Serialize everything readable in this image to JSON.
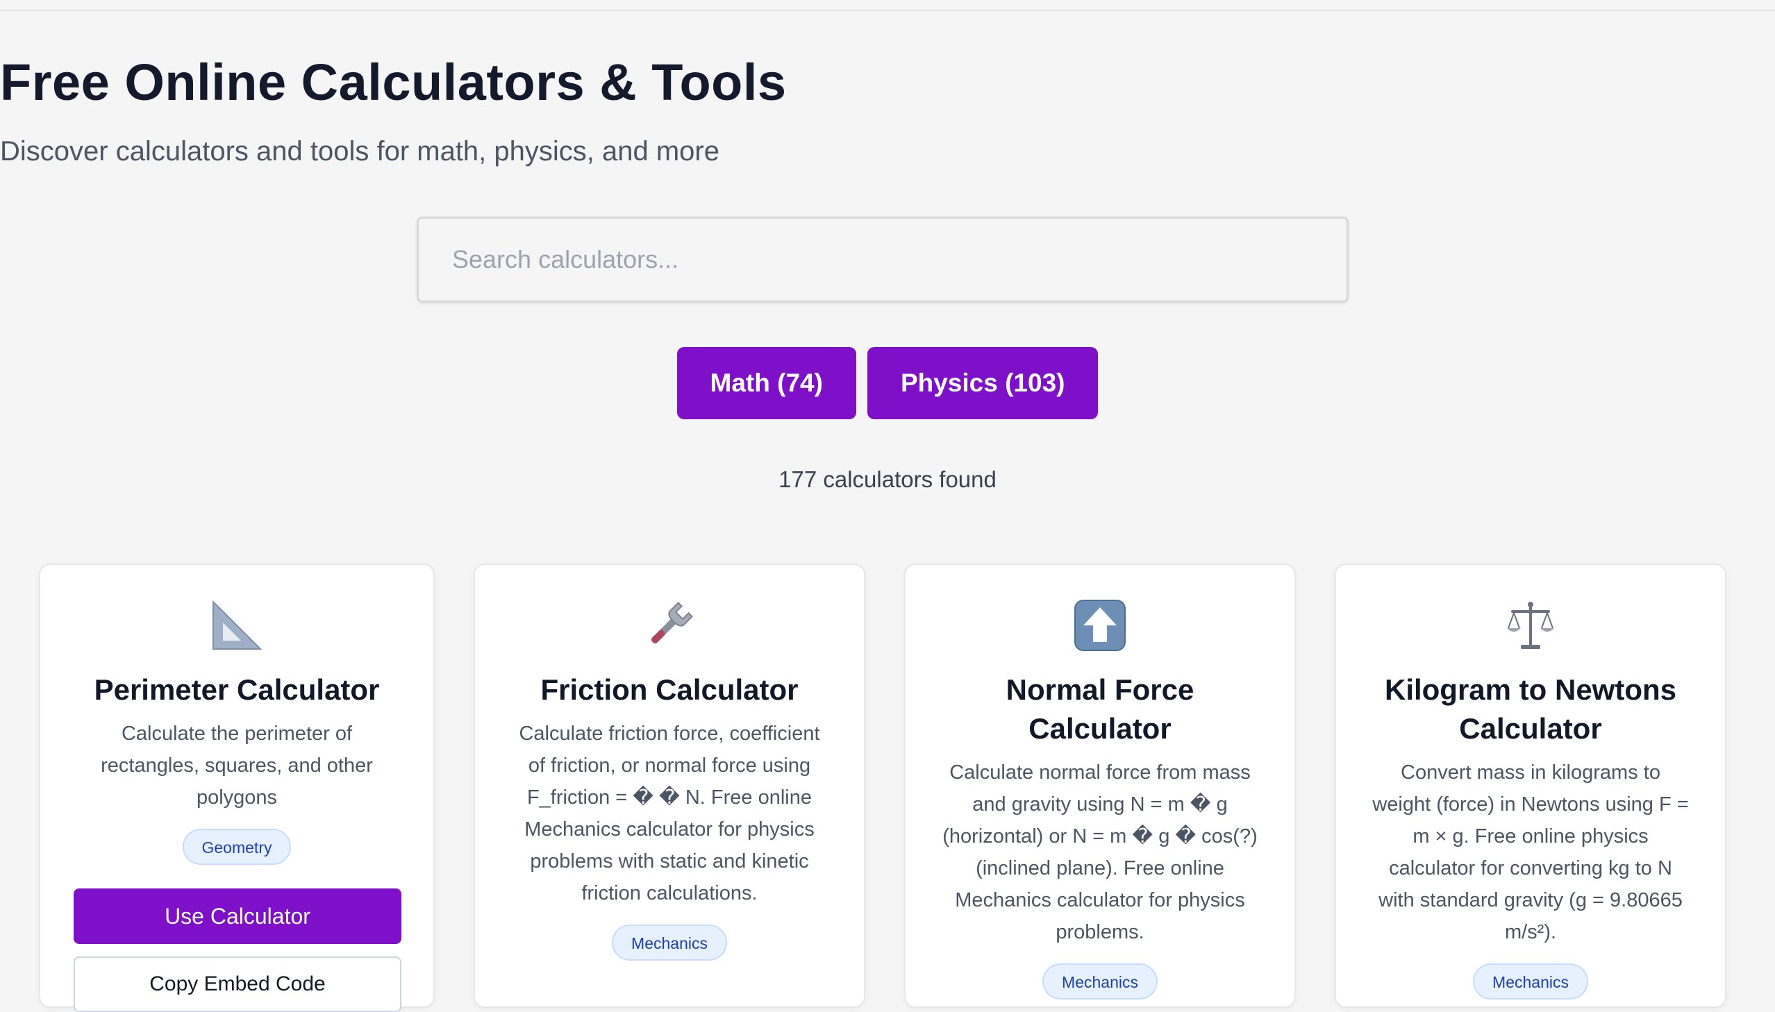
{
  "header": {
    "title": "Free Online Calculators & Tools",
    "subtitle": "Discover calculators and tools for math, physics, and more"
  },
  "search": {
    "placeholder": "Search calculators...",
    "value": ""
  },
  "filters": [
    {
      "label": "Math (74)"
    },
    {
      "label": "Physics (103)"
    }
  ],
  "results_count": "177 calculators found",
  "cards": [
    {
      "icon": "triangular-ruler-icon",
      "title": "Perimeter Calculator",
      "description": "Calculate the perimeter of rectangles, squares, and other polygons",
      "badge": "Geometry",
      "use_label": "Use Calculator",
      "embed_label": "Copy Embed Code"
    },
    {
      "icon": "wrench-icon",
      "title": "Friction Calculator",
      "description": "Calculate friction force, coefficient of friction, or normal force using F_friction = � � N. Free online Mechanics calculator for physics problems with static and kinetic friction calculations.",
      "badge": "Mechanics"
    },
    {
      "icon": "up-arrow-icon",
      "title": "Normal Force Calculator",
      "description": "Calculate normal force from mass and gravity using N = m � g (horizontal) or N = m � g � cos(?) (inclined plane). Free online Mechanics calculator for physics problems.",
      "badge": "Mechanics"
    },
    {
      "icon": "balance-scale-icon",
      "title": "Kilogram to Newtons Calculator",
      "description": "Convert mass in kilograms to weight (force) in Newtons using F = m × g. Free online physics calculator for converting kg to N with standard gravity (g = 9.80665 m/s²).",
      "badge": "Mechanics"
    }
  ],
  "colors": {
    "accent": "#7e10c9",
    "badge_bg": "#e7f0fe",
    "badge_text": "#1e40af"
  }
}
